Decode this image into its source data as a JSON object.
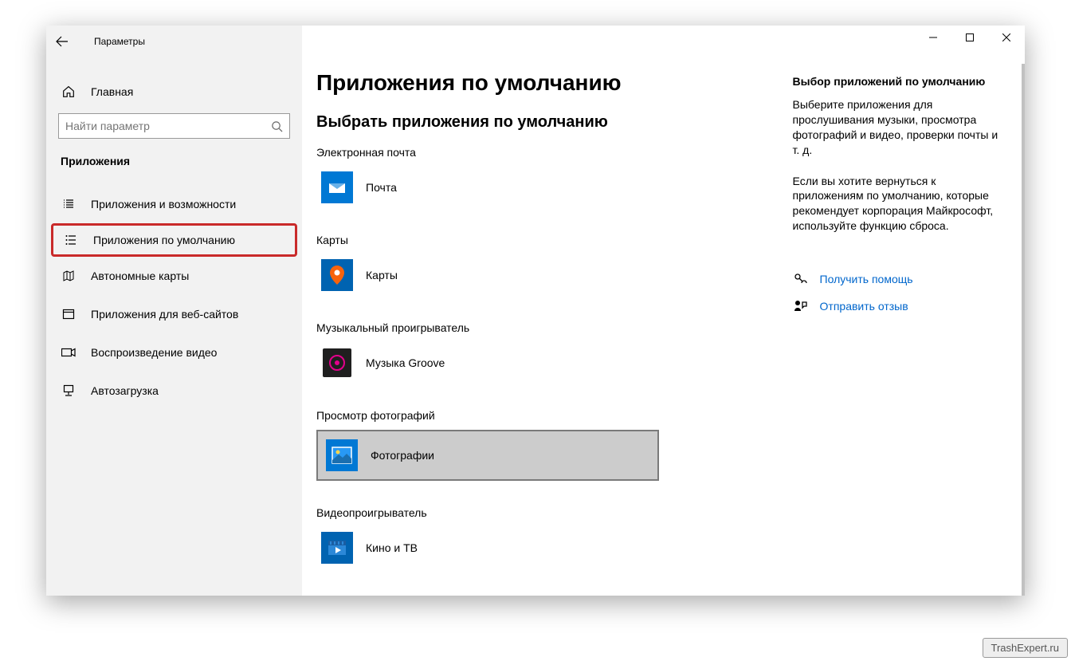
{
  "window": {
    "title": "Параметры"
  },
  "sidebar": {
    "home": "Главная",
    "search_placeholder": "Найти параметр",
    "section": "Приложения",
    "items": [
      {
        "label": "Приложения и возможности"
      },
      {
        "label": "Приложения по умолчанию"
      },
      {
        "label": "Автономные карты"
      },
      {
        "label": "Приложения для веб-сайтов"
      },
      {
        "label": "Воспроизведение видео"
      },
      {
        "label": "Автозагрузка"
      }
    ]
  },
  "main": {
    "title": "Приложения по умолчанию",
    "subtitle": "Выбрать приложения по умолчанию",
    "categories": [
      {
        "label": "Электронная почта",
        "app": "Почта"
      },
      {
        "label": "Карты",
        "app": "Карты"
      },
      {
        "label": "Музыкальный проигрыватель",
        "app": "Музыка Groove"
      },
      {
        "label": "Просмотр фотографий",
        "app": "Фотографии"
      },
      {
        "label": "Видеопроигрыватель",
        "app": "Кино и ТВ"
      }
    ]
  },
  "right": {
    "heading": "Выбор приложений по умолчанию",
    "p1": "Выберите приложения для прослушивания музыки, просмотра фотографий и видео, проверки почты и т. д.",
    "p2": "Если вы хотите вернуться к приложениям по умолчанию, которые рекомендует корпорация Майкрософт, используйте функцию сброса.",
    "help": "Получить помощь",
    "feedback": "Отправить отзыв"
  },
  "watermark": "TrashExpert.ru"
}
